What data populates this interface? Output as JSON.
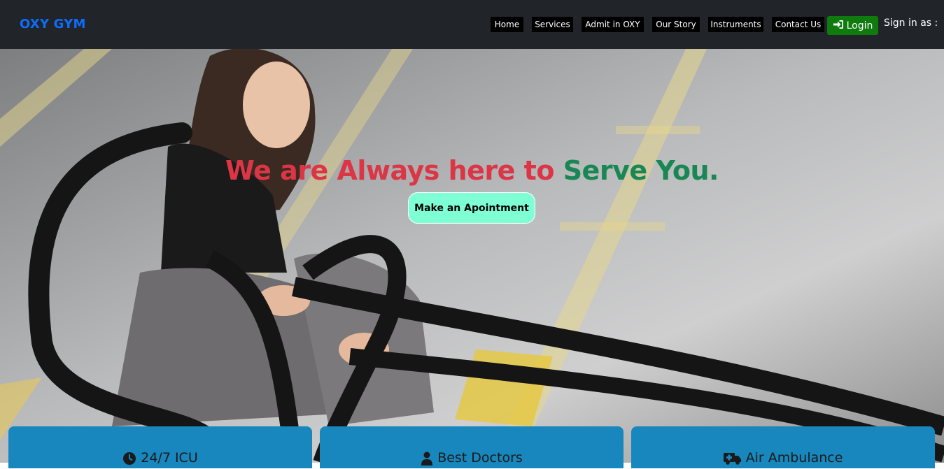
{
  "navbar": {
    "brand": "OXY GYM",
    "items": [
      {
        "label": "Home"
      },
      {
        "label": "Services"
      },
      {
        "label": "Admit in OXY"
      },
      {
        "label": "Our Story"
      },
      {
        "label": "Instruments"
      },
      {
        "label": "Contact Us"
      }
    ],
    "login_label": "Login",
    "login_icon": "sign-in-icon",
    "signin_text": "Sign in as :"
  },
  "hero": {
    "title_part1": "We are Always here to",
    "title_part2": "Serve You.",
    "cta_label": "Make an Apointment",
    "image": "woman-with-battle-ropes-photo"
  },
  "cards": [
    {
      "label": "24/7 ICU",
      "icon": "clock-icon"
    },
    {
      "label": "Best Doctors",
      "icon": "user-doctor-icon"
    },
    {
      "label": "Air Ambulance",
      "icon": "ambulance-icon"
    }
  ],
  "colors": {
    "navbar_bg": "#212529",
    "brand": "#0d6efd",
    "login_bg": "#0f7b0f",
    "title_red": "#dc3545",
    "title_green": "#198754",
    "cta_bg": "#7fffd4",
    "card_bg": "#1787bd"
  }
}
